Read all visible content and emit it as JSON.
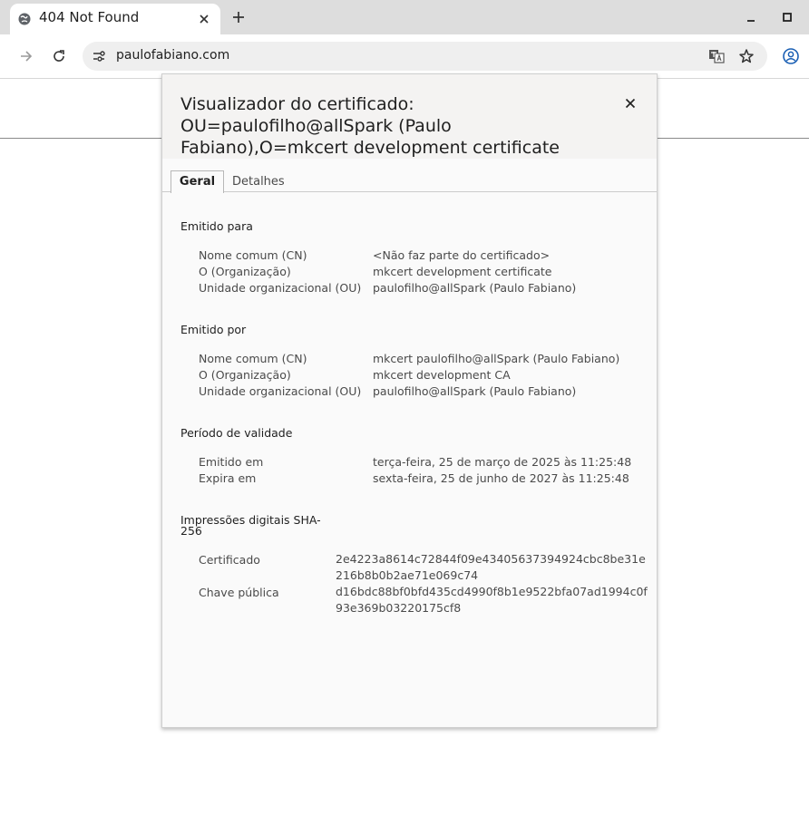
{
  "browser": {
    "tab_title": "404 Not Found",
    "url": "paulofabiano.com"
  },
  "dialog": {
    "title": "Visualizador do certificado: OU=paulofilho@allSpark (Paulo Fabiano),O=mkcert development certificate",
    "tabs": [
      "Geral",
      "Detalhes"
    ],
    "issued_to": {
      "heading": "Emitido para",
      "rows": [
        {
          "label": "Nome comum (CN)",
          "value": "<Não faz parte do certificado>"
        },
        {
          "label": "O (Organização)",
          "value": "mkcert development certificate"
        },
        {
          "label": "Unidade organizacional (OU)",
          "value": "paulofilho@allSpark (Paulo Fabiano)"
        }
      ]
    },
    "issued_by": {
      "heading": "Emitido por",
      "rows": [
        {
          "label": "Nome comum (CN)",
          "value": "mkcert paulofilho@allSpark (Paulo Fabiano)"
        },
        {
          "label": "O (Organização)",
          "value": "mkcert development CA"
        },
        {
          "label": "Unidade organizacional (OU)",
          "value": "paulofilho@allSpark (Paulo Fabiano)"
        }
      ]
    },
    "validity": {
      "heading": "Período de validade",
      "rows": [
        {
          "label": "Emitido em",
          "value": "terça-feira, 25 de março de 2025 às 11:25:48"
        },
        {
          "label": "Expira em",
          "value": "sexta-feira, 25 de junho de 2027 às 11:25:48"
        }
      ]
    },
    "fingerprints": {
      "heading_line1": "Impressões digitais SHA-",
      "heading_line2": "256",
      "certificate_label": "Certificado",
      "certificate_line1": "2e4223a8614c72844f09e43405637394924cbc8be31e",
      "certificate_line2": "216b8b0b2ae71e069c74",
      "public_key_label": "Chave pública",
      "public_key_line1": "d16bdc88bf0bfd435cd4990f8b1e9522bfa07ad1994c0f",
      "public_key_line2": "93e369b03220175cf8"
    }
  }
}
